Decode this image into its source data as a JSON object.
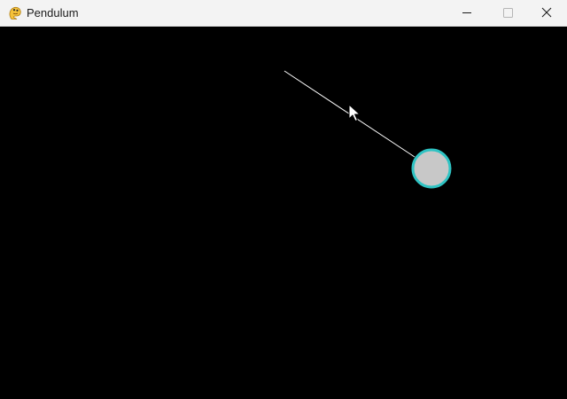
{
  "window": {
    "title": "Pendulum",
    "app_icon": "pygame-snake-icon",
    "controls": {
      "minimize_icon": "minimize-icon",
      "maximize_icon": "maximize-icon",
      "close_icon": "close-icon"
    }
  },
  "scene": {
    "background_color": "#000000",
    "rod_color": "#ffffff",
    "bob_fill_color": "#c8c8c8",
    "bob_outline_color": "#2fc3c3",
    "cursor_icon": "mouse-pointer-icon"
  }
}
